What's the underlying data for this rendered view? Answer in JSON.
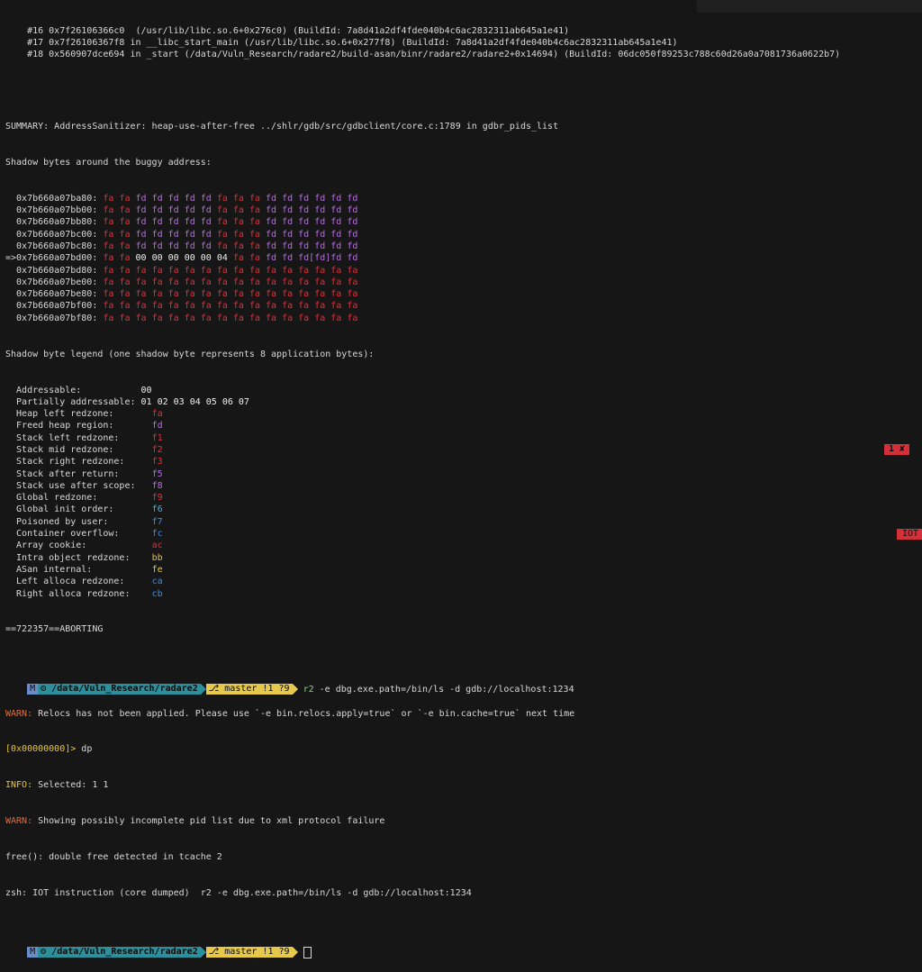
{
  "backtrace": [
    "    #16 0x7f26106366c0  (/usr/lib/libc.so.6+0x276c0) (BuildId: 7a8d41a2df4fde040b4c6ac2832311ab645a1e41)",
    "    #17 0x7f26106367f8 in __libc_start_main (/usr/lib/libc.so.6+0x277f8) (BuildId: 7a8d41a2df4fde040b4c6ac2832311ab645a1e41)",
    "    #18 0x560907dce694 in _start (/data/Vuln_Research/radare2/build-asan/binr/radare2/radare2+0x14694) (BuildId: 06dc050f89253c788c60d26a0a7081736a0622b7)"
  ],
  "summary": "SUMMARY: AddressSanitizer: heap-use-after-free ../shlr/gdb/src/gdbclient/core.c:1789 in gdbr_pids_list",
  "shadow_header": "Shadow bytes around the buggy address:",
  "shadow_rows": [
    {
      "prefix": "  ",
      "addr": "0x7b660a07ba80:",
      "bytes": [
        "fa",
        "fa",
        "fd",
        "fd",
        "fd",
        "fd",
        "fd",
        "fa",
        "fa",
        "fa",
        "fd",
        "fd",
        "fd",
        "fd",
        "fd",
        "fd"
      ]
    },
    {
      "prefix": "  ",
      "addr": "0x7b660a07bb00:",
      "bytes": [
        "fa",
        "fa",
        "fd",
        "fd",
        "fd",
        "fd",
        "fd",
        "fa",
        "fa",
        "fa",
        "fd",
        "fd",
        "fd",
        "fd",
        "fd",
        "fd"
      ]
    },
    {
      "prefix": "  ",
      "addr": "0x7b660a07bb80:",
      "bytes": [
        "fa",
        "fa",
        "fd",
        "fd",
        "fd",
        "fd",
        "fd",
        "fa",
        "fa",
        "fa",
        "fd",
        "fd",
        "fd",
        "fd",
        "fd",
        "fd"
      ]
    },
    {
      "prefix": "  ",
      "addr": "0x7b660a07bc00:",
      "bytes": [
        "fa",
        "fa",
        "fd",
        "fd",
        "fd",
        "fd",
        "fd",
        "fa",
        "fa",
        "fa",
        "fd",
        "fd",
        "fd",
        "fd",
        "fd",
        "fd"
      ]
    },
    {
      "prefix": "  ",
      "addr": "0x7b660a07bc80:",
      "bytes": [
        "fa",
        "fa",
        "fd",
        "fd",
        "fd",
        "fd",
        "fd",
        "fa",
        "fa",
        "fa",
        "fd",
        "fd",
        "fd",
        "fd",
        "fd",
        "fd"
      ]
    },
    {
      "prefix": "=>",
      "addr": "0x7b660a07bd00:",
      "bytes": [
        "fa",
        "fa",
        "00",
        "00",
        "00",
        "00",
        "00",
        "04",
        "fa",
        "fa",
        "fd",
        "fd",
        "fd",
        "[fd]",
        "fd",
        "fd"
      ]
    },
    {
      "prefix": "  ",
      "addr": "0x7b660a07bd80:",
      "bytes": [
        "fa",
        "fa",
        "fa",
        "fa",
        "fa",
        "fa",
        "fa",
        "fa",
        "fa",
        "fa",
        "fa",
        "fa",
        "fa",
        "fa",
        "fa",
        "fa"
      ]
    },
    {
      "prefix": "  ",
      "addr": "0x7b660a07be00:",
      "bytes": [
        "fa",
        "fa",
        "fa",
        "fa",
        "fa",
        "fa",
        "fa",
        "fa",
        "fa",
        "fa",
        "fa",
        "fa",
        "fa",
        "fa",
        "fa",
        "fa"
      ]
    },
    {
      "prefix": "  ",
      "addr": "0x7b660a07be80:",
      "bytes": [
        "fa",
        "fa",
        "fa",
        "fa",
        "fa",
        "fa",
        "fa",
        "fa",
        "fa",
        "fa",
        "fa",
        "fa",
        "fa",
        "fa",
        "fa",
        "fa"
      ]
    },
    {
      "prefix": "  ",
      "addr": "0x7b660a07bf00:",
      "bytes": [
        "fa",
        "fa",
        "fa",
        "fa",
        "fa",
        "fa",
        "fa",
        "fa",
        "fa",
        "fa",
        "fa",
        "fa",
        "fa",
        "fa",
        "fa",
        "fa"
      ]
    },
    {
      "prefix": "  ",
      "addr": "0x7b660a07bf80:",
      "bytes": [
        "fa",
        "fa",
        "fa",
        "fa",
        "fa",
        "fa",
        "fa",
        "fa",
        "fa",
        "fa",
        "fa",
        "fa",
        "fa",
        "fa",
        "fa",
        "fa"
      ]
    }
  ],
  "legend_header": "Shadow byte legend (one shadow byte represents 8 application bytes):",
  "legend": [
    {
      "label": "  Addressable:           ",
      "value": "00",
      "color": "#f0f0f0"
    },
    {
      "label": "  Partially addressable: ",
      "value": "01 02 03 04 05 06 07",
      "color": "#f0f0f0"
    },
    {
      "label": "  Heap left redzone:       ",
      "value": "fa",
      "color": "#e0303a"
    },
    {
      "label": "  Freed heap region:       ",
      "value": "fd",
      "color": "#b76ee0"
    },
    {
      "label": "  Stack left redzone:      ",
      "value": "f1",
      "color": "#e0303a"
    },
    {
      "label": "  Stack mid redzone:       ",
      "value": "f2",
      "color": "#e0303a"
    },
    {
      "label": "  Stack right redzone:     ",
      "value": "f3",
      "color": "#e0303a"
    },
    {
      "label": "  Stack after return:      ",
      "value": "f5",
      "color": "#b76ee0"
    },
    {
      "label": "  Stack use after scope:   ",
      "value": "f8",
      "color": "#b76ee0"
    },
    {
      "label": "  Global redzone:          ",
      "value": "f9",
      "color": "#e0303a"
    },
    {
      "label": "  Global init order:       ",
      "value": "f6",
      "color": "#3fb6d8"
    },
    {
      "label": "  Poisoned by user:        ",
      "value": "f7",
      "color": "#3c8ee8"
    },
    {
      "label": "  Container overflow:      ",
      "value": "fc",
      "color": "#3c8ee8"
    },
    {
      "label": "  Array cookie:            ",
      "value": "ac",
      "color": "#e0303a"
    },
    {
      "label": "  Intra object redzone:    ",
      "value": "bb",
      "color": "#e8c440"
    },
    {
      "label": "  ASan internal:           ",
      "value": "fe",
      "color": "#e8c440"
    },
    {
      "label": "  Left alloca redzone:     ",
      "value": "ca",
      "color": "#3c8ee8"
    },
    {
      "label": "  Right alloca redzone:    ",
      "value": "cb",
      "color": "#3c8ee8"
    }
  ],
  "aborting": "==722357==ABORTING",
  "prompt1": {
    "os_icon": "M",
    "dir": "/data/Vuln_Research/radare2",
    "branch": "master !1 ?9",
    "cmd_first": "r2",
    "cmd_rest": " -e dbg.exe.path=/bin/ls -d gdb://localhost:1234",
    "status": "1 ✘"
  },
  "output": {
    "warn1_tag": "WARN:",
    "warn1": " Relocs has not been applied. Please use `-e bin.relocs.apply=true` or `-e bin.cache=true` next time",
    "r2_prompt": "[0x00000000]>",
    "r2_cmd": " dp",
    "info_tag": "INFO:",
    "info": " Selected: 1 1",
    "warn2_tag": "WARN:",
    "warn2": " Showing possibly incomplete pid list due to xml protocol failure",
    "free_err": "free(): double free detected in tcache 2",
    "zsh": "zsh: IOT instruction (core dumped)  r2 -e dbg.exe.path=/bin/ls -d gdb://localhost:1234"
  },
  "prompt2": {
    "os_icon": "M",
    "dir": "/data/Vuln_Research/radare2",
    "branch": "master !1 ?9",
    "status": "IOT"
  },
  "colors": {
    "fa": "#e0303a",
    "fd": "#b76ee0",
    "00": "#f0f0f0",
    "04": "#f0f0f0",
    "[fd]": "#b76ee0"
  }
}
